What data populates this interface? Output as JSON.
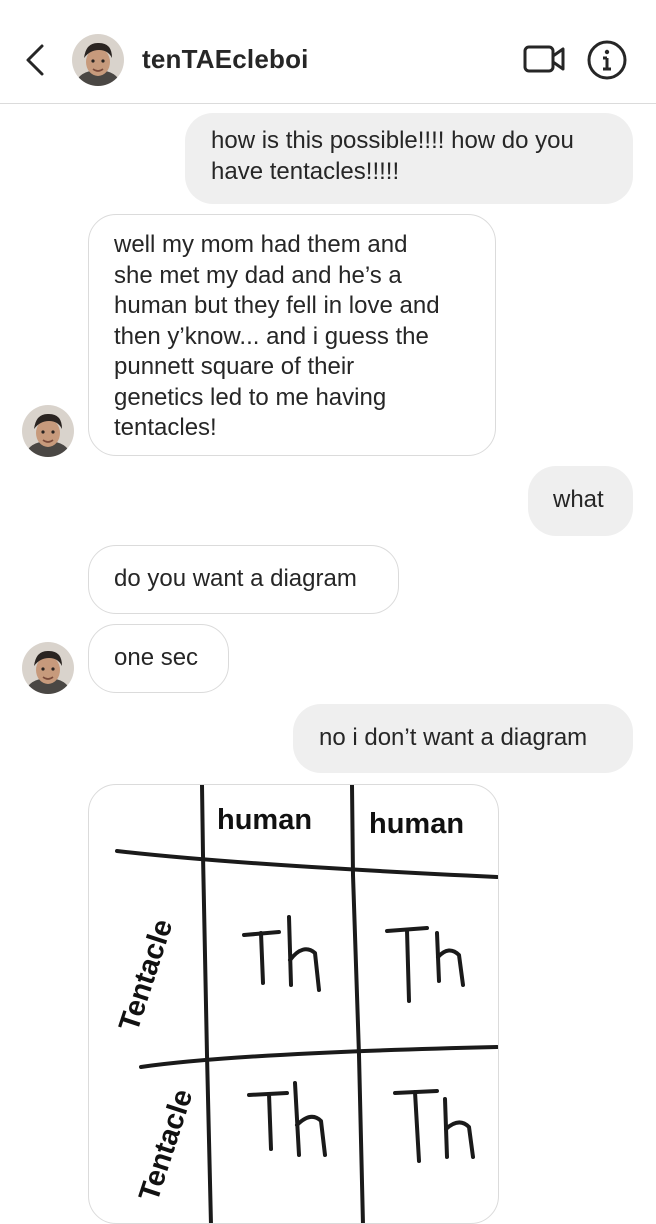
{
  "header": {
    "username": "tenTAEcleboi"
  },
  "messages": [
    {
      "direction": "outgoing",
      "text": "how is this possible!!!! how do you\nhave tentacles!!!!!"
    },
    {
      "direction": "incoming",
      "text": "well my mom had them and\nshe met my dad and he’s a\nhuman but they fell in love and\nthen y’know... and i guess the\npunnett square of their\ngenetics led to me having\ntentacles!"
    },
    {
      "direction": "outgoing",
      "text": "what"
    },
    {
      "direction": "incoming",
      "text": "do you want a diagram"
    },
    {
      "direction": "incoming",
      "text": "one sec"
    },
    {
      "direction": "outgoing",
      "text": "no i don’t want a diagram"
    }
  ],
  "diagram": {
    "column_headers": [
      "human",
      "human"
    ],
    "row_headers": [
      "Tentacle",
      "Tentacle"
    ],
    "cells": [
      "Th",
      "Th",
      "Th",
      "Th"
    ]
  },
  "icons": {
    "back": "chevron-left-icon",
    "video": "video-camera-icon",
    "info": "info-circle-icon"
  },
  "colors": {
    "outgoing_bubble": "#efefef",
    "incoming_border": "#dbdbdb",
    "text": "#262626"
  }
}
